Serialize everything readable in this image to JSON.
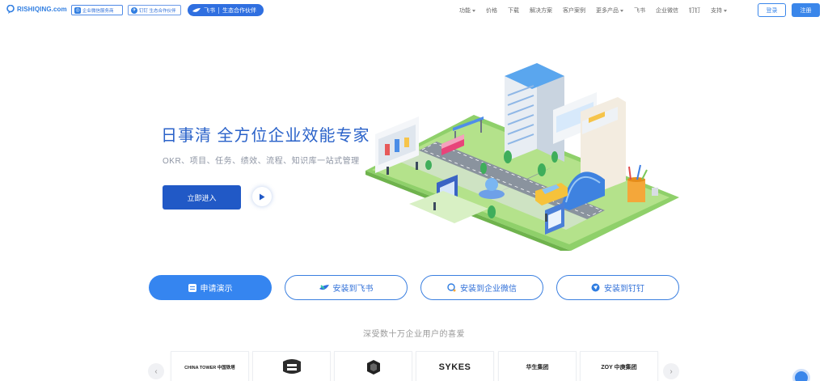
{
  "header": {
    "logo_text": "RISHIQING.com",
    "badge_wecom": "企业微信服务商",
    "badge_dingtalk": "钉钉 生态合作伙伴",
    "badge_feishu_name": "飞书",
    "badge_feishu_text": "生态合作伙伴",
    "nav": [
      {
        "label": "功能",
        "dropdown": true
      },
      {
        "label": "价格",
        "dropdown": false
      },
      {
        "label": "下载",
        "dropdown": false
      },
      {
        "label": "解决方案",
        "dropdown": false
      },
      {
        "label": "客户案例",
        "dropdown": false
      },
      {
        "label": "更多产品",
        "dropdown": true
      },
      {
        "label": "飞书",
        "dropdown": false
      },
      {
        "label": "企业微信",
        "dropdown": false
      },
      {
        "label": "钉钉",
        "dropdown": false
      },
      {
        "label": "支持",
        "dropdown": true
      }
    ],
    "login_label": "登录",
    "signup_label": "注册"
  },
  "hero": {
    "title": "日事清  全方位企业效能专家",
    "subtitle": "OKR、项目、任务、绩效、流程、知识库一站式管理",
    "enter_label": "立即进入"
  },
  "actions": {
    "demo_label": "申请演示",
    "feishu_label": "安装到飞书",
    "wecom_label": "安装到企业微信",
    "dingtalk_label": "安装到钉钉"
  },
  "customers": {
    "heading": "深受数十万企业用户的喜爱",
    "logos": [
      "CHINA TOWER 中国铁塔",
      "",
      "",
      "SYKES",
      "华生集团",
      "ZOY 中庚集团"
    ]
  },
  "colors": {
    "brand": "#3585f0",
    "brand_dark": "#2159c6",
    "title_blue": "#2a62c9"
  }
}
